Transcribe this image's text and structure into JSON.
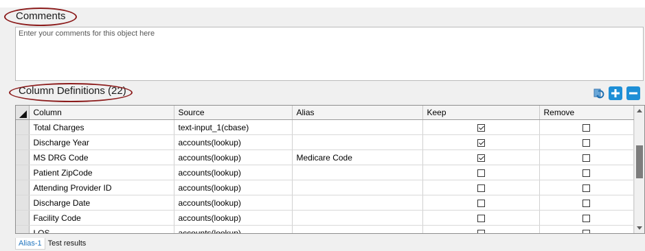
{
  "comments": {
    "title": "Comments",
    "placeholder": "Enter your comments for this object here"
  },
  "column_definitions": {
    "title": "Column Definitions (22)",
    "toolbar": {
      "refresh_icon": "refresh-icon",
      "add_icon": "plus-icon",
      "remove_icon": "minus-icon"
    },
    "headers": [
      "Column",
      "Source",
      "Alias",
      "Keep",
      "Remove"
    ],
    "rows": [
      {
        "column": "Total Charges",
        "source": "text-input_1(cbase)",
        "alias": "",
        "keep": true,
        "remove": false
      },
      {
        "column": "Discharge Year",
        "source": "accounts(lookup)",
        "alias": "",
        "keep": true,
        "remove": false
      },
      {
        "column": "MS DRG Code",
        "source": "accounts(lookup)",
        "alias": "Medicare Code",
        "keep": true,
        "remove": false
      },
      {
        "column": "Patient ZipCode",
        "source": "accounts(lookup)",
        "alias": "",
        "keep": false,
        "remove": false
      },
      {
        "column": "Attending Provider ID",
        "source": "accounts(lookup)",
        "alias": "",
        "keep": false,
        "remove": false
      },
      {
        "column": "Discharge Date",
        "source": "accounts(lookup)",
        "alias": "",
        "keep": false,
        "remove": false
      },
      {
        "column": "Facility Code",
        "source": "accounts(lookup)",
        "alias": "",
        "keep": false,
        "remove": false
      },
      {
        "column": "LOS",
        "source": "accounts(lookup)",
        "alias": "",
        "keep": false,
        "remove": false
      }
    ]
  },
  "tabs": [
    {
      "label": "Alias-1",
      "active": true
    },
    {
      "label": "Test results",
      "active": false
    }
  ],
  "colors": {
    "accent": "#1e8fd6",
    "annotation_oval": "#8b1a1a",
    "active_tab_text": "#1e73be"
  }
}
